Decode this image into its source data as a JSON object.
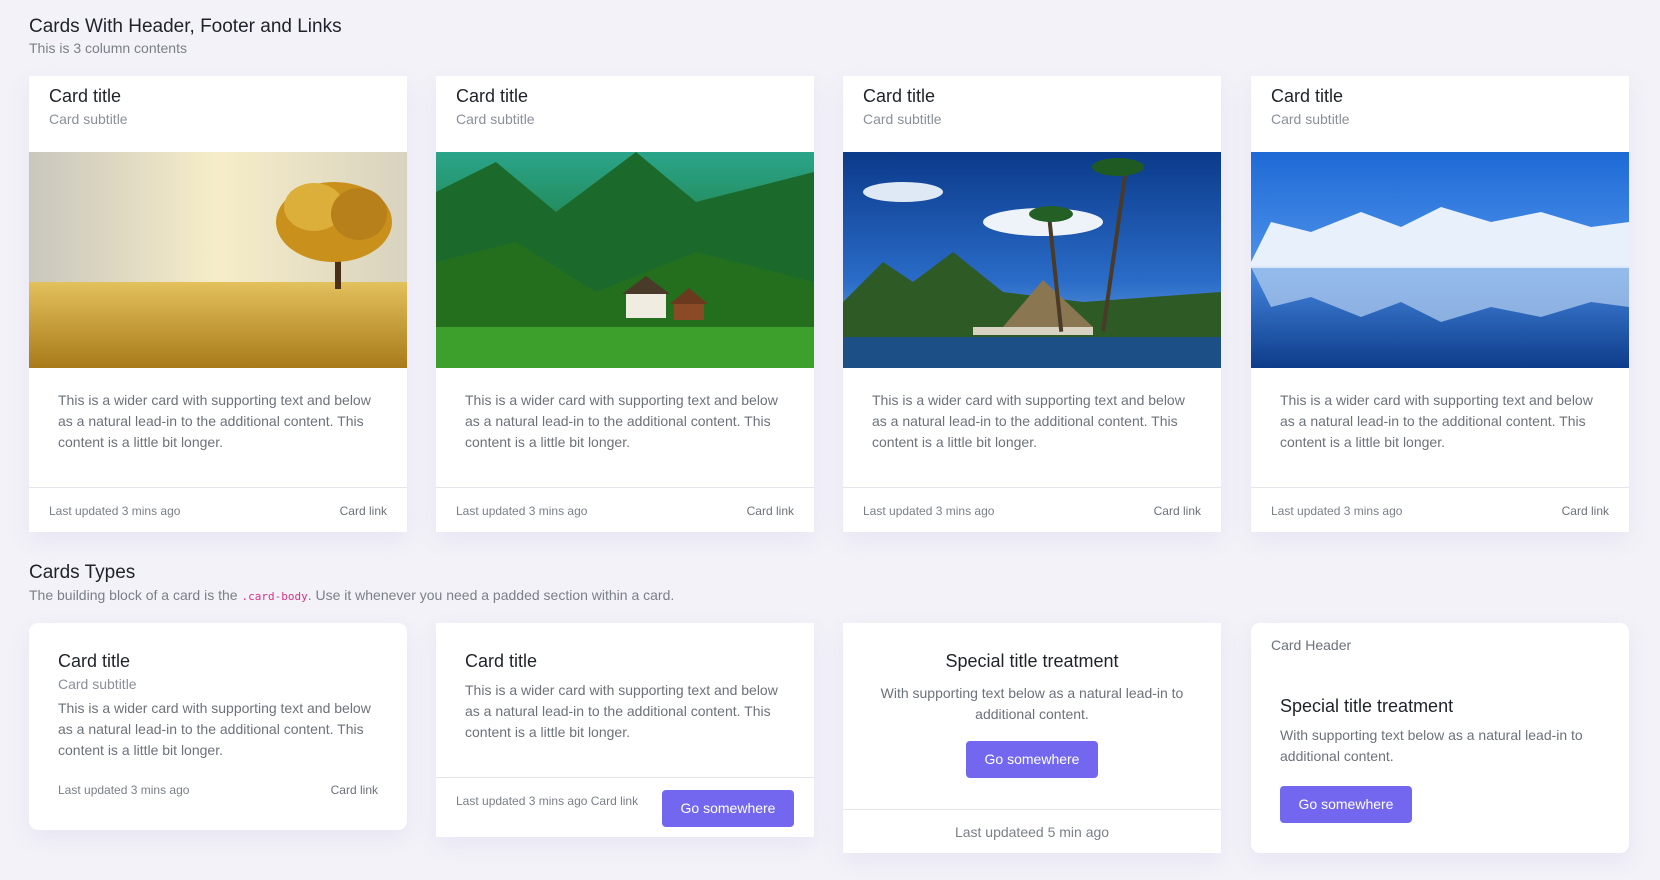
{
  "section1": {
    "title": "Cards With Header, Footer and Links",
    "subtitle": "This is 3 column contents"
  },
  "image_cards": [
    {
      "title": "Card title",
      "subtitle": "Card subtitle",
      "image": "autumn-tree-field",
      "text": "This is a wider card with supporting text and below as a natural lead-in to the additional content. This content is a little bit longer.",
      "footer": "Last updated 3 mins ago",
      "link": "Card link"
    },
    {
      "title": "Card title",
      "subtitle": "Card subtitle",
      "image": "forest-valley-house",
      "text": "This is a wider card with supporting text and below as a natural lead-in to the additional content. This content is a little bit longer.",
      "footer": "Last updated 3 mins ago",
      "link": "Card link"
    },
    {
      "title": "Card title",
      "subtitle": "Card subtitle",
      "image": "tropical-beach-hut",
      "text": "This is a wider card with supporting text and below as a natural lead-in to the additional content. This content is a little bit longer.",
      "footer": "Last updated 3 mins ago",
      "link": "Card link"
    },
    {
      "title": "Card title",
      "subtitle": "Card subtitle",
      "image": "frozen-lake-trees",
      "text": "This is a wider card with supporting text and below as a natural lead-in to the additional content. This content is a little bit longer.",
      "footer": "Last updated 3 mins ago",
      "link": "Card link"
    }
  ],
  "section2": {
    "title": "Cards Types",
    "subtitle_before": "The building block of a card is the ",
    "subtitle_code": ".card-body",
    "subtitle_after": ". Use it whenever you need a padded section within a card."
  },
  "type_cards": {
    "card1": {
      "title": "Card title",
      "subtitle": "Card subtitle",
      "text": "This is a wider card with supporting text and below as a natural lead-in to the additional content. This content is a little bit longer.",
      "footer": "Last updated 3 mins ago",
      "link": "Card link"
    },
    "card2": {
      "title": "Card title",
      "text": "This is a wider card with supporting text and below as a natural lead-in to the additional content. This content is a little bit longer.",
      "footer": "Last updated 3 mins ago Card link",
      "button": "Go somewhere"
    },
    "card3": {
      "title": "Special title treatment",
      "text": "With supporting text below as a natural lead-in to additional content.",
      "button": "Go somewhere",
      "footer": "Last updateed 5 min ago"
    },
    "card4": {
      "header": "Card Header",
      "title": "Special title treatment",
      "text": "With supporting text below as a natural lead-in to additional content.",
      "button": "Go somewhere"
    }
  },
  "colors": {
    "accent": "#7367f0",
    "background": "#f3f2f8"
  }
}
